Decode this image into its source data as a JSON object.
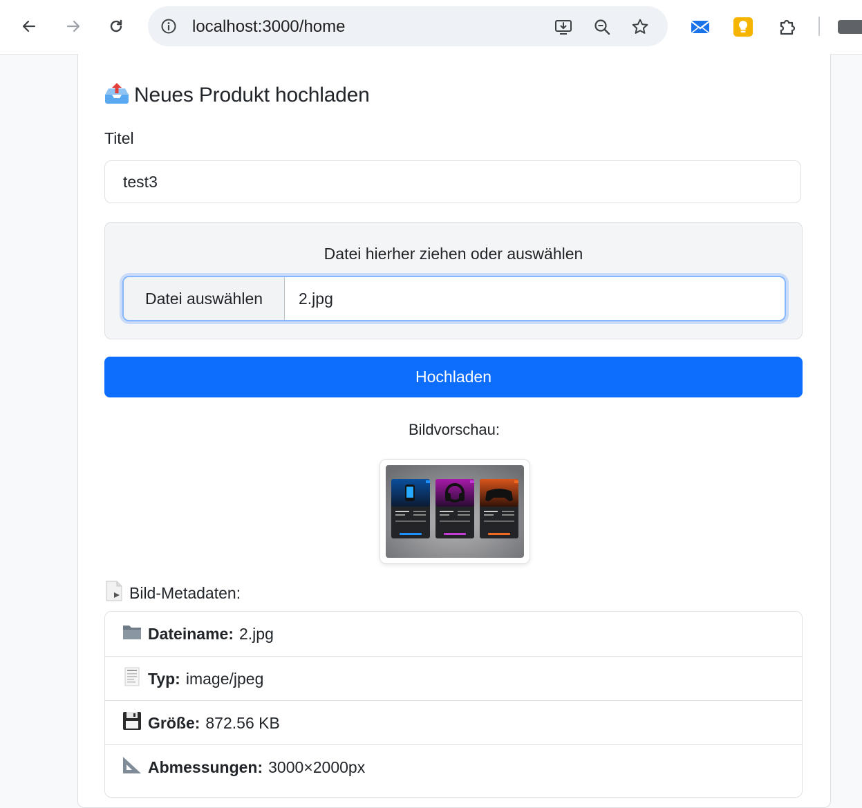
{
  "browser": {
    "url": "localhost:3000/home",
    "nav": [
      "back-arrow-icon",
      "forward-arrow-icon",
      "reload-icon"
    ],
    "omnibox_icons": [
      "install-app-icon",
      "zoom-icon",
      "bookmark-star-icon"
    ],
    "extensions": [
      "mail-extension-icon",
      "bulb-extension-icon",
      "extensions-puzzle-icon"
    ]
  },
  "page": {
    "heading": "Neues Produkt hochladen",
    "title_label": "Titel",
    "title_value": "test3",
    "dropzone_label": "Datei hierher ziehen oder auswählen",
    "file_button": "Datei auswählen",
    "file_name": "2.jpg",
    "upload_button": "Hochladen",
    "preview_label": "Bildvorschau:",
    "meta_heading": "Bild-Metadaten:",
    "metadata": [
      {
        "icon": "folder-icon",
        "label": "Dateiname:",
        "value": "2.jpg"
      },
      {
        "icon": "document-icon",
        "label": "Typ:",
        "value": "image/jpeg"
      },
      {
        "icon": "floppy-disk-icon",
        "label": "Größe:",
        "value": "872.56 KB"
      },
      {
        "icon": "triangle-ruler-icon",
        "label": "Abmessungen:",
        "value": "3000×2000px"
      }
    ]
  },
  "colors": {
    "primary": "#0d6efd",
    "focus_ring": "#86b7fe",
    "border": "#dee2e6",
    "dropzone_bg": "#f4f5f7"
  }
}
